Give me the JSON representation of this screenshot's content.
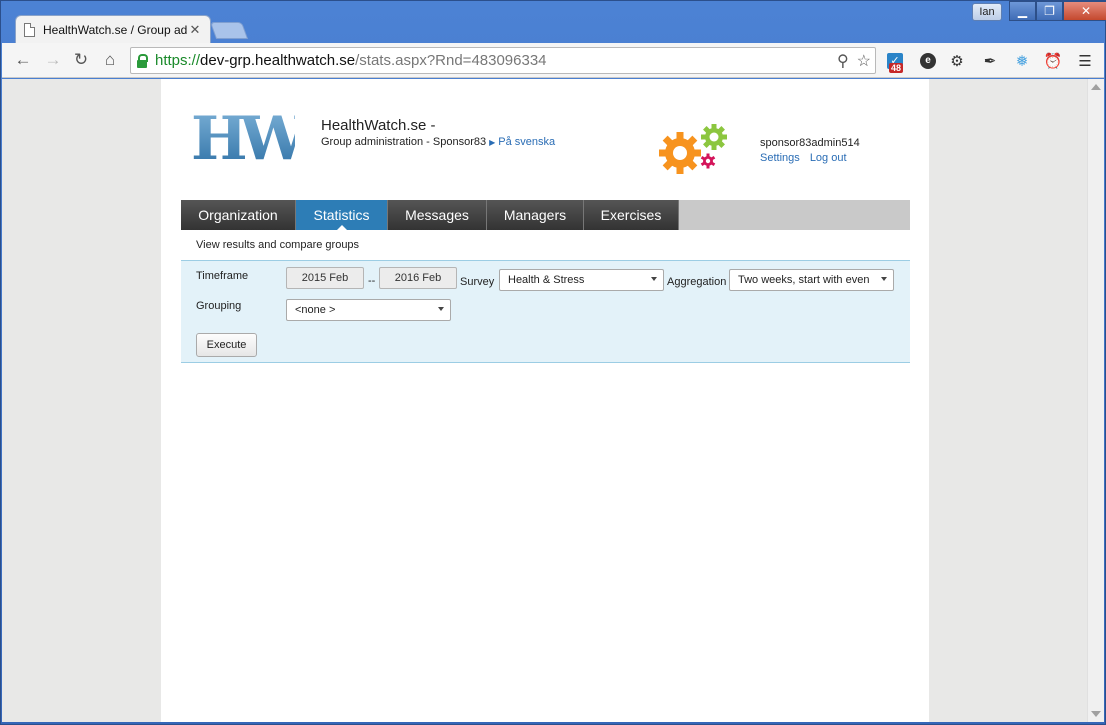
{
  "browser": {
    "tab_title": "HealthWatch.se / Group adm",
    "tab_close": "✕",
    "user_badge": "Ian",
    "url_scheme": "https://",
    "url_host": "dev-grp.healthwatch.se",
    "url_path": "/stats.aspx?Rnd=483096334",
    "extension_badge": "48"
  },
  "header": {
    "title": "HealthWatch.se -",
    "subtitle": "Group administration - Sponsor83",
    "language_link": "På svenska",
    "username": "sponsor83admin514",
    "settings_link": "Settings",
    "logout_link": "Log out",
    "logo_text": "HW"
  },
  "nav": {
    "tabs": [
      {
        "label": "Organization",
        "active": false
      },
      {
        "label": "Statistics",
        "active": true
      },
      {
        "label": "Messages",
        "active": false
      },
      {
        "label": "Managers",
        "active": false
      },
      {
        "label": "Exercises",
        "active": false
      }
    ],
    "sub_label": "View results and compare groups"
  },
  "filters": {
    "timeframe_label": "Timeframe",
    "from": "2015 Feb",
    "separator": "--",
    "to": "2016 Feb",
    "survey_label": "Survey",
    "survey_value": "Health & Stress",
    "aggregation_label": "Aggregation",
    "aggregation_value": "Two weeks, start with even",
    "grouping_label": "Grouping",
    "grouping_value": "<none >",
    "execute_label": "Execute"
  },
  "colors": {
    "nav_active": "#2d7db6",
    "nav_inactive": "#444444",
    "link": "#2a6db5",
    "filter_bg": "#e3f2f9"
  }
}
